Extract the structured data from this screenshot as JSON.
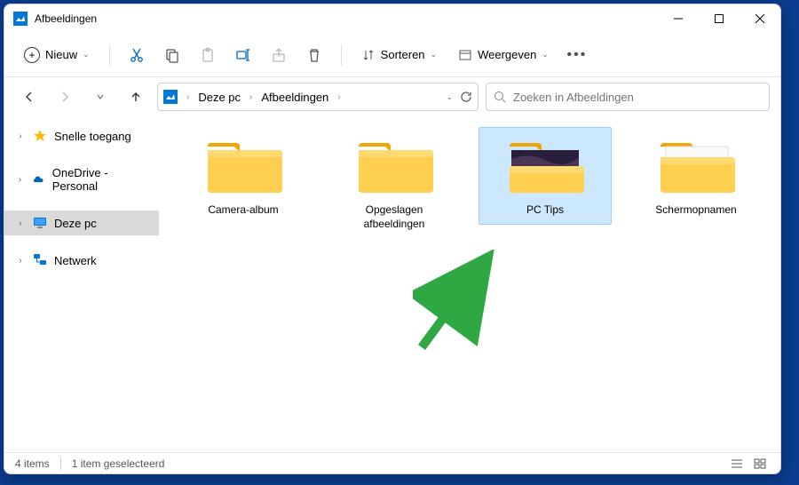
{
  "window": {
    "title": "Afbeeldingen"
  },
  "toolbar": {
    "new_label": "Nieuw",
    "sort_label": "Sorteren",
    "view_label": "Weergeven"
  },
  "breadcrumb": {
    "root": "Deze pc",
    "current": "Afbeeldingen"
  },
  "search": {
    "placeholder": "Zoeken in Afbeeldingen"
  },
  "sidebar": {
    "items": [
      {
        "label": "Snelle toegang"
      },
      {
        "label": "OneDrive - Personal"
      },
      {
        "label": "Deze pc"
      },
      {
        "label": "Netwerk"
      }
    ]
  },
  "folders": [
    {
      "label": "Camera-album"
    },
    {
      "label": "Opgeslagen afbeeldingen"
    },
    {
      "label": "PC Tips"
    },
    {
      "label": "Schermopnamen"
    }
  ],
  "status": {
    "count": "4 items",
    "selection": "1 item geselecteerd"
  }
}
